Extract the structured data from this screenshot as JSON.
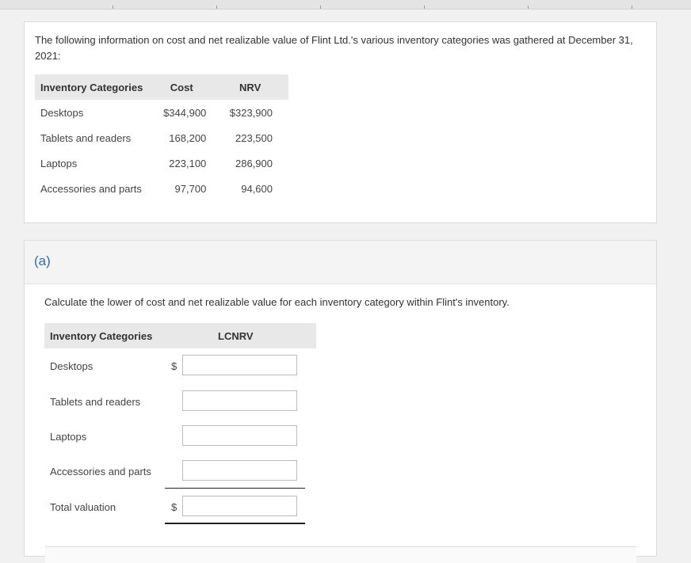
{
  "intro_text": "The following information on cost and net realizable value of Flint Ltd.'s various inventory categories was gathered at December 31, 2021:",
  "info_table": {
    "headers": [
      "Inventory Categories",
      "Cost",
      "NRV"
    ],
    "rows": [
      [
        "Desktops",
        "$344,900",
        "$323,900"
      ],
      [
        "Tablets and readers",
        "168,200",
        "223,500"
      ],
      [
        "Laptops",
        "223,100",
        "286,900"
      ],
      [
        "Accessories and parts",
        "97,700",
        "94,600"
      ]
    ]
  },
  "part": {
    "label": "(a)",
    "question": "Calculate the lower of cost and net realizable value for each inventory category within Flint's inventory.",
    "headers": [
      "Inventory Categories",
      "LCNRV"
    ],
    "rows": [
      {
        "label": "Desktops",
        "currency": "$",
        "value": ""
      },
      {
        "label": "Tablets and readers",
        "currency": "",
        "value": ""
      },
      {
        "label": "Laptops",
        "currency": "",
        "value": ""
      },
      {
        "label": "Accessories and parts",
        "currency": "",
        "value": ""
      },
      {
        "label": "Total valuation",
        "currency": "$",
        "value": ""
      }
    ]
  },
  "colors": {
    "accent": "#2a6ebb",
    "header_bg": "#e8e8e8"
  }
}
